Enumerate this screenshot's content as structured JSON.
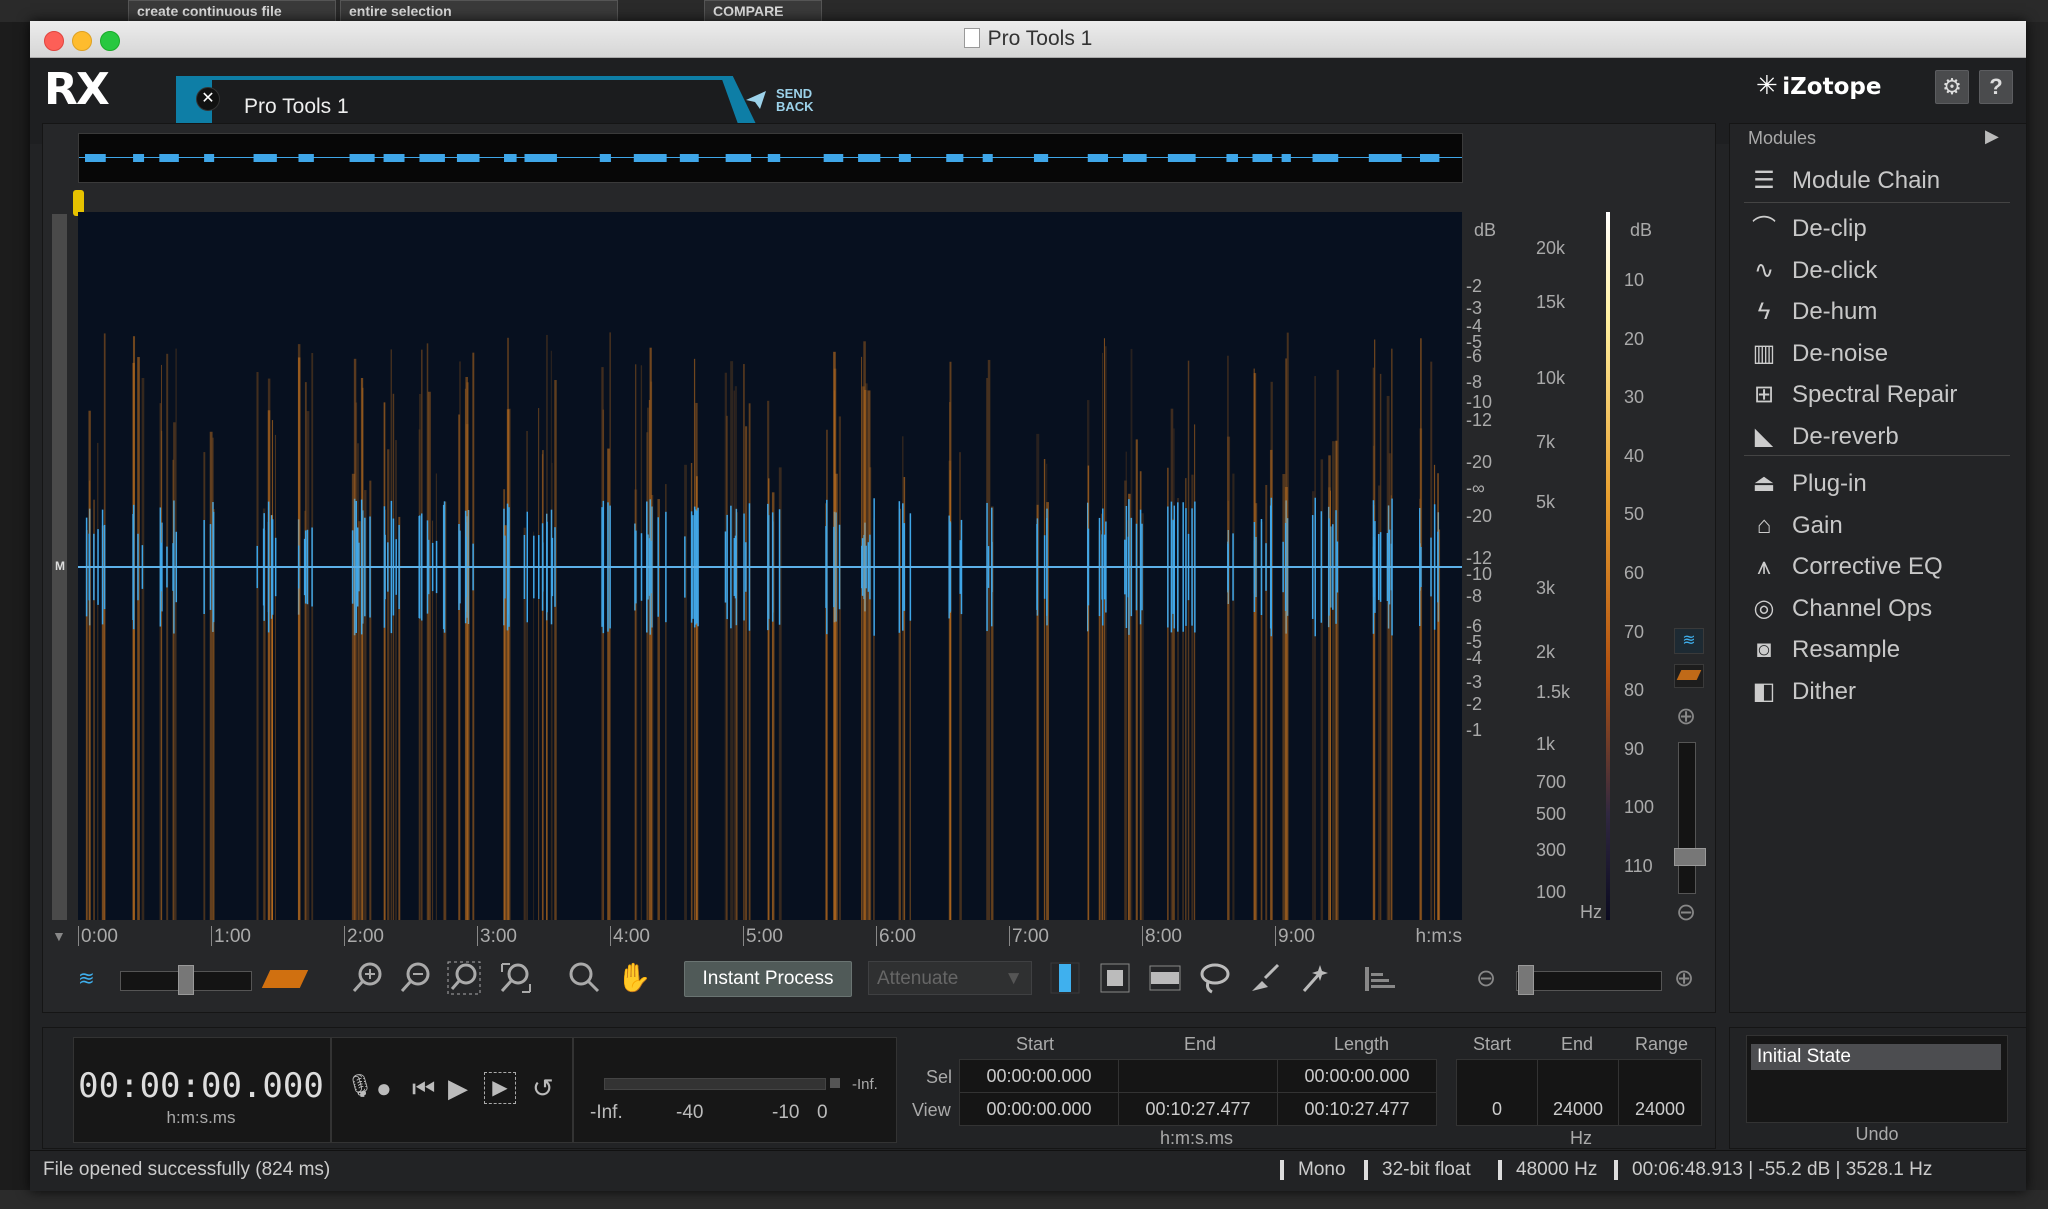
{
  "host": {
    "buttons": [
      "create continuous file",
      "entire selection",
      "COMPARE"
    ]
  },
  "window": {
    "title": "Pro Tools 1"
  },
  "header": {
    "logo": "RX",
    "tab_label": "Pro Tools 1",
    "send_back_line1": "SEND",
    "send_back_line2": "BACK",
    "brand": "iZotope",
    "help": "?"
  },
  "spectrogram": {
    "db_unit": "dB",
    "db_scale": [
      "-2",
      "-3",
      "-4",
      "-5",
      "-6",
      "-8",
      "-10",
      "-12",
      "-20",
      "-∞",
      "-20",
      "-12",
      "-10",
      "-8",
      "-6",
      "-5",
      "-4",
      "-3",
      "-2",
      "-1"
    ],
    "freq_scale": [
      "20k",
      "15k",
      "10k",
      "7k",
      "5k",
      "3k",
      "2k",
      "1.5k",
      "1k",
      "700",
      "500",
      "300",
      "100"
    ],
    "freq_unit": "Hz",
    "colorbar_unit": "dB",
    "colorbar_scale": [
      "10",
      "20",
      "30",
      "40",
      "50",
      "60",
      "70",
      "80",
      "90",
      "100",
      "110"
    ],
    "time_ticks": [
      "0:00",
      "1:00",
      "2:00",
      "3:00",
      "4:00",
      "5:00",
      "6:00",
      "7:00",
      "8:00",
      "9:00"
    ],
    "time_unit": "h:m:s",
    "channel_label": "M"
  },
  "toolbar": {
    "instant_process": "Instant Process",
    "attenuate": "Attenuate"
  },
  "modules": {
    "header": "Modules",
    "group1": [
      {
        "label": "Module Chain",
        "icon": "module-chain-icon"
      }
    ],
    "group2": [
      {
        "label": "De-clip",
        "icon": "declip-icon"
      },
      {
        "label": "De-click",
        "icon": "declick-icon"
      },
      {
        "label": "De-hum",
        "icon": "dehum-icon"
      },
      {
        "label": "De-noise",
        "icon": "denoise-icon"
      },
      {
        "label": "Spectral Repair",
        "icon": "spectral-repair-icon"
      },
      {
        "label": "De-reverb",
        "icon": "dereverb-icon"
      }
    ],
    "group3": [
      {
        "label": "Plug-in",
        "icon": "plugin-icon"
      },
      {
        "label": "Gain",
        "icon": "gain-icon"
      },
      {
        "label": "Corrective EQ",
        "icon": "eq-icon"
      },
      {
        "label": "Channel Ops",
        "icon": "channel-ops-icon"
      },
      {
        "label": "Resample",
        "icon": "resample-icon"
      },
      {
        "label": "Dither",
        "icon": "dither-icon"
      }
    ]
  },
  "transport": {
    "timecode": "00:00:00.000",
    "timecode_format": "h:m:s.ms",
    "meter_peak": "-Inf.",
    "meter_labels": [
      "-Inf.",
      "-40",
      "-10",
      "0"
    ]
  },
  "selection": {
    "col_start": "Start",
    "col_end": "End",
    "col_length": "Length",
    "row_sel": "Sel",
    "row_view": "View",
    "sel_start": "00:00:00.000",
    "sel_end": "",
    "sel_length": "00:00:00.000",
    "view_start": "00:00:00.000",
    "view_end": "00:10:27.477",
    "view_length": "00:10:27.477",
    "time_format": "h:m:s.ms",
    "freq_col_start": "Start",
    "freq_col_end": "End",
    "freq_col_range": "Range",
    "freq_start": "0",
    "freq_end": "24000",
    "freq_range": "24000",
    "freq_unit": "Hz"
  },
  "undo": {
    "item": "Initial State",
    "label": "Undo"
  },
  "status": {
    "message": "File opened successfully (824 ms)",
    "channels": "Mono",
    "bit_depth": "32-bit float",
    "sample_rate": "48000 Hz",
    "cursor": "00:06:48.913 | -55.2 dB | 3528.1 Hz"
  },
  "colors": {
    "accent": "#0e7ea6",
    "waveform": "#3fa6e8",
    "spectrum": "#e0801e"
  }
}
